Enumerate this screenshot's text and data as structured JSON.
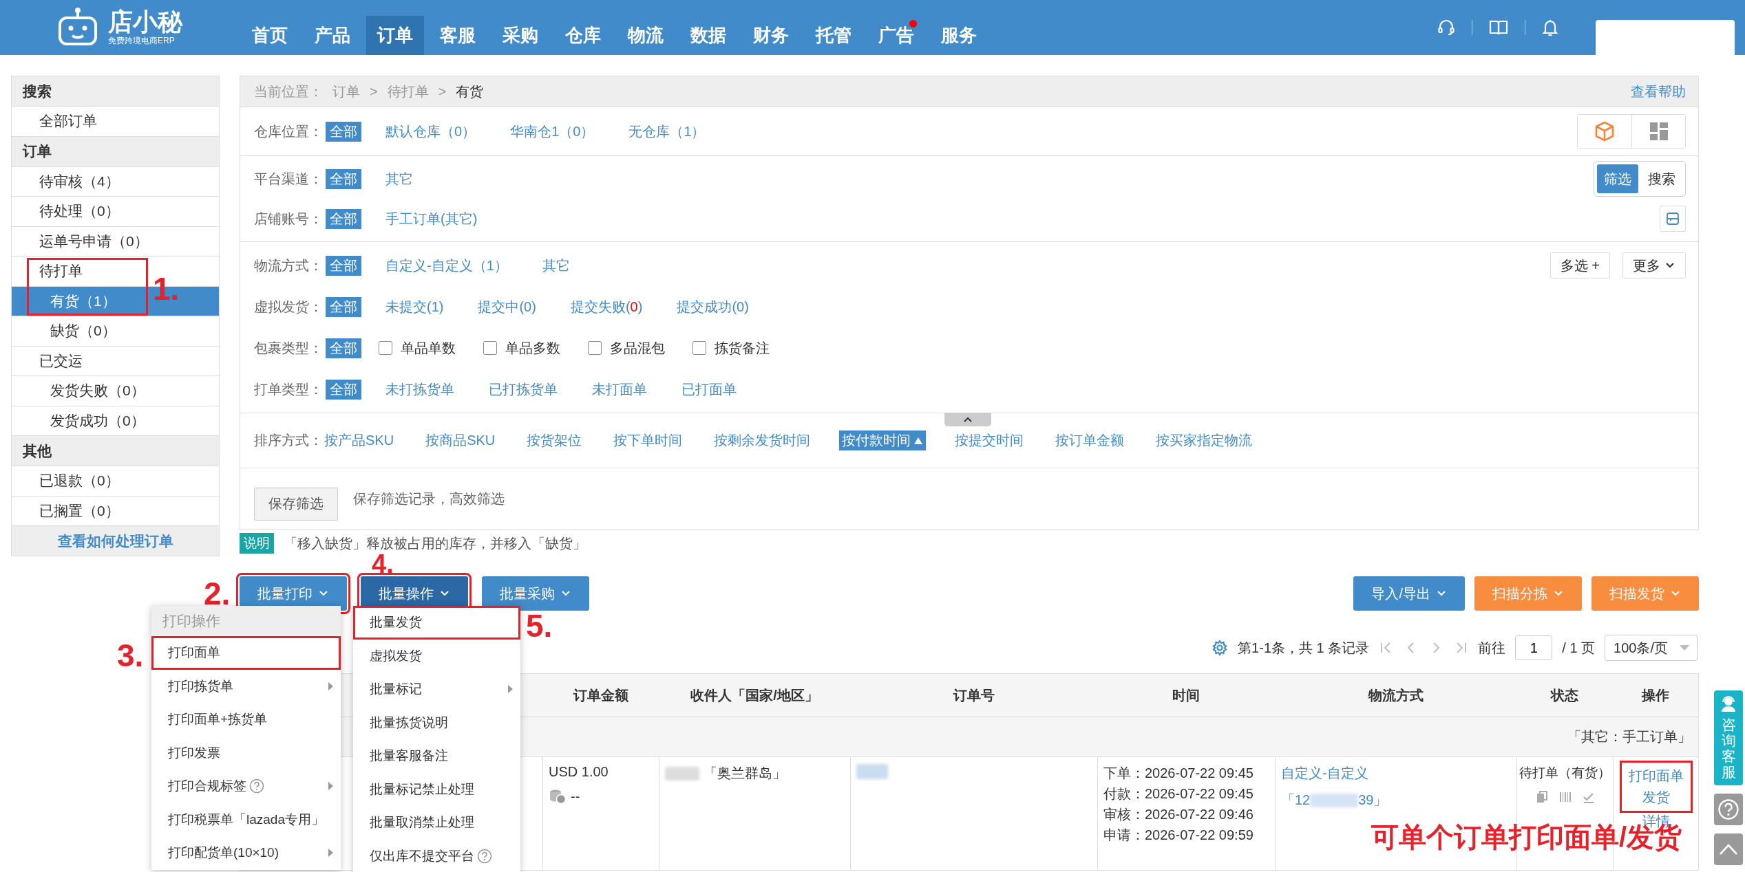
{
  "header": {
    "logo_title": "店小秘",
    "logo_subtitle": "免费跨境电商ERP",
    "nav": [
      {
        "label": "首页",
        "selected": false,
        "dot": false
      },
      {
        "label": "产品",
        "selected": false,
        "dot": false
      },
      {
        "label": "订单",
        "selected": true,
        "dot": false
      },
      {
        "label": "客服",
        "selected": false,
        "dot": false
      },
      {
        "label": "采购",
        "selected": false,
        "dot": false
      },
      {
        "label": "仓库",
        "selected": false,
        "dot": false
      },
      {
        "label": "物流",
        "selected": false,
        "dot": false
      },
      {
        "label": "数据",
        "selected": false,
        "dot": false
      },
      {
        "label": "财务",
        "selected": false,
        "dot": false
      },
      {
        "label": "托管",
        "selected": false,
        "dot": false
      },
      {
        "label": "广告",
        "selected": false,
        "dot": true
      },
      {
        "label": "服务",
        "selected": false,
        "dot": false
      }
    ]
  },
  "sidebar": {
    "groups": [
      {
        "title": "搜索",
        "items": [
          {
            "label": "全部订单",
            "selected": false
          }
        ]
      },
      {
        "title": "订单",
        "items": [
          {
            "label": "待审核（4）",
            "selected": false
          },
          {
            "label": "待处理（0）",
            "selected": false
          },
          {
            "label": "运单号申请（0）",
            "selected": false
          },
          {
            "label": "待打单",
            "selected": false,
            "callout": "1.",
            "children": [
              {
                "label": "有货（1）",
                "selected": true
              },
              {
                "label": "缺货（0）",
                "selected": false
              }
            ]
          },
          {
            "label": "已交运",
            "selected": false,
            "children": [
              {
                "label": "发货失败（0）",
                "selected": false
              },
              {
                "label": "发货成功（0）",
                "selected": false
              }
            ]
          }
        ]
      },
      {
        "title": "其他",
        "items": [
          {
            "label": "已退款（0）",
            "selected": false
          },
          {
            "label": "已搁置（0）",
            "selected": false
          }
        ]
      }
    ],
    "help_link": "查看如何处理订单"
  },
  "breadcrumb": {
    "label": "当前位置：",
    "path": [
      "订单",
      ">",
      "待打单",
      ">",
      "有货"
    ],
    "help": "查看帮助"
  },
  "filter_sections": [
    {
      "rows": [
        {
          "label": "仓库位置：",
          "kind": "links",
          "options": [
            {
              "label": "全部",
              "selected": true
            },
            {
              "label": "默认仓库（0）",
              "selected": false
            },
            {
              "label": "华南仓1（0）",
              "selected": false
            },
            {
              "label": "无仓库（1）",
              "selected": false
            }
          ],
          "tools": {
            "kind": "view-toggle",
            "items": [
              {
                "selected": true
              },
              {
                "selected": false
              }
            ]
          }
        }
      ]
    },
    {
      "rows": [
        {
          "label": "平台渠道：",
          "kind": "links",
          "options": [
            {
              "label": "全部",
              "selected": true
            },
            {
              "label": "其它",
              "selected": false
            }
          ],
          "tools": {
            "kind": "segmented",
            "items": [
              {
                "label": "筛选",
                "selected": true
              },
              {
                "label": "搜索",
                "selected": false
              }
            ]
          }
        },
        {
          "label": "店铺账号：",
          "kind": "links",
          "options": [
            {
              "label": "全部",
              "selected": true
            },
            {
              "label": "手工订单(其它)",
              "selected": false
            }
          ],
          "tools": {
            "kind": "icon-button"
          }
        }
      ]
    },
    {
      "rows": [
        {
          "label": "物流方式：",
          "kind": "links",
          "options": [
            {
              "label": "全部",
              "selected": true
            },
            {
              "label": "自定义-自定义（1）",
              "selected": false
            },
            {
              "label": "其它",
              "selected": false
            }
          ],
          "tools": {
            "kind": "buttons",
            "items": [
              {
                "label": "多选 +",
                "caret": false
              },
              {
                "label": "更多",
                "caret": true
              }
            ]
          }
        },
        {
          "label": "虚拟发货：",
          "kind": "links",
          "options": [
            {
              "label": "全部",
              "selected": true
            },
            {
              "label": "未提交(1)",
              "selected": false
            },
            {
              "label": "提交中(0)",
              "selected": false
            },
            {
              "label": "提交失败(",
              "count": "0",
              "after": ")",
              "alert": true,
              "selected": false
            },
            {
              "label": "提交成功(0)",
              "selected": false
            }
          ]
        },
        {
          "label": "包裹类型：",
          "kind": "checkboxes",
          "options": [
            {
              "label": "全部",
              "selected": true
            },
            {
              "label": "单品单数",
              "checked": false
            },
            {
              "label": "单品多数",
              "checked": false
            },
            {
              "label": "多品混包",
              "checked": false
            },
            {
              "label": "拣货备注",
              "checked": false
            }
          ]
        },
        {
          "label": "打单类型：",
          "kind": "links",
          "options": [
            {
              "label": "全部",
              "selected": true
            },
            {
              "label": "未打拣货单",
              "selected": false
            },
            {
              "label": "已打拣货单",
              "selected": false
            },
            {
              "label": "未打面单",
              "selected": false
            },
            {
              "label": "已打面单",
              "selected": false
            }
          ]
        }
      ]
    }
  ],
  "sort": {
    "label": "排序方式：",
    "options": [
      {
        "label": "按产品SKU",
        "selected": false
      },
      {
        "label": "按商品SKU",
        "selected": false
      },
      {
        "label": "按货架位",
        "selected": false
      },
      {
        "label": "按下单时间",
        "selected": false
      },
      {
        "label": "按剩余发货时间",
        "selected": false
      },
      {
        "label": "按付款时间",
        "selected": true
      },
      {
        "label": "按提交时间",
        "selected": false
      },
      {
        "label": "按订单金额",
        "selected": false
      },
      {
        "label": "按买家指定物流",
        "selected": false
      }
    ]
  },
  "save": {
    "button": "保存筛选",
    "hint": "保存筛选记录，高效筛选"
  },
  "note": {
    "badge": "说明",
    "text": "「移入缺货」释放被占用的库存，并移入「缺货」"
  },
  "toolbar": {
    "left": [
      {
        "label": "批量打印",
        "kind": "primary",
        "pressed": false,
        "callout": "2."
      },
      {
        "label": "批量操作",
        "kind": "primary",
        "pressed": true,
        "callout": "4."
      },
      {
        "label": "批量采购",
        "kind": "primary",
        "pressed": false
      }
    ],
    "right": [
      {
        "label": "导入/导出",
        "kind": "primary"
      },
      {
        "label": "扫描分拣",
        "kind": "warning"
      },
      {
        "label": "扫描发货",
        "kind": "warning"
      }
    ]
  },
  "menus": [
    {
      "header": "打印操作",
      "items": [
        {
          "label": "打印面单",
          "submenu": false,
          "help": false,
          "callout": "3."
        },
        {
          "label": "打印拣货单",
          "submenu": true,
          "help": false
        },
        {
          "label": "打印面单+拣货单",
          "submenu": false,
          "help": false
        },
        {
          "label": "打印发票",
          "submenu": false,
          "help": false
        },
        {
          "label": "打印合规标签",
          "submenu": true,
          "help": true
        },
        {
          "label": "打印税票单「lazada专用」",
          "submenu": false,
          "help": false
        },
        {
          "label": "打印配货单(10×10)",
          "submenu": true,
          "help": false
        }
      ]
    },
    {
      "items": [
        {
          "label": "批量发货",
          "submenu": false,
          "help": false,
          "callout": "5."
        },
        {
          "label": "虚拟发货",
          "submenu": false,
          "help": false
        },
        {
          "label": "批量标记",
          "submenu": true,
          "help": false
        },
        {
          "label": "批量拣货说明",
          "submenu": false,
          "help": false
        },
        {
          "label": "批量客服备注",
          "submenu": false,
          "help": false
        },
        {
          "label": "批量标记禁止处理",
          "submenu": false,
          "help": false
        },
        {
          "label": "批量取消禁止处理",
          "submenu": false,
          "help": false
        },
        {
          "label": "仅出库不提交平台",
          "submenu": false,
          "help": true
        }
      ]
    }
  ],
  "pagination": {
    "summary": "第1-1条，共 1 条记录",
    "goto": "前往",
    "page": "1",
    "total": "/ 1 页",
    "page_size": "100条/页"
  },
  "table": {
    "columns": [
      "订单金额",
      "收件人「国家/地区」",
      "订单号",
      "时间",
      "物流方式",
      "状态",
      "操作"
    ],
    "group_label": "「其它：手工订单」",
    "rows": [
      {
        "amount": "USD 1.00",
        "profit": "--",
        "country": "「奥兰群岛」",
        "times": [
          "下单：2026-07-22 09:45",
          "付款：2026-07-22 09:45",
          "审核：2026-07-22 09:46",
          "申请：2026-07-22 09:59"
        ],
        "logistics": "自定义-自定义",
        "tracking_prefix": "「12",
        "tracking_suffix": "39」",
        "status": "待打单（有货）",
        "actions": [
          {
            "label": "打印面单",
            "highlighted": true
          },
          {
            "label": "发货",
            "highlighted": true
          },
          {
            "label": "详情",
            "highlighted": false
          }
        ]
      }
    ]
  },
  "annotation": "可单个订单打印面单/发货",
  "float_tools": {
    "consult": "咨询客服"
  }
}
